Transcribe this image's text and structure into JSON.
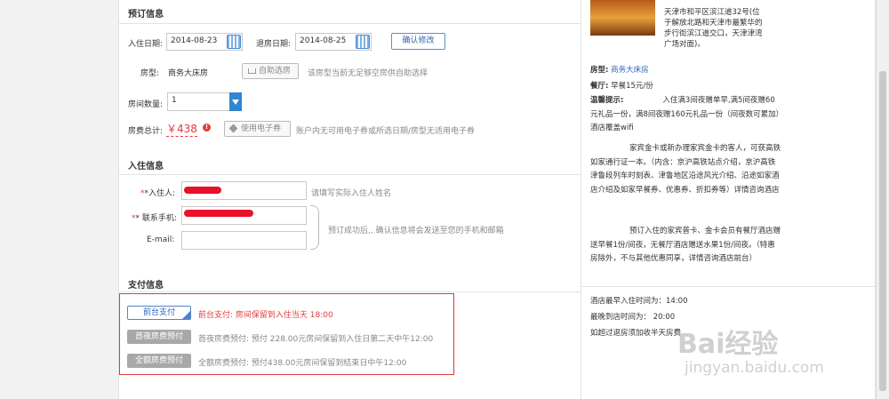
{
  "booking": {
    "section_title": "预订信息",
    "checkin_label": "入住日期:",
    "checkin_value": "2014-08-23",
    "checkout_label": "退房日期:",
    "checkout_value": "2014-08-25",
    "confirm_button": "确认修改",
    "room_type_label": "房型:",
    "room_type_value": "商务大床房",
    "self_select_button": "自助选房",
    "self_select_note": "该房型当前无足够空房供自助选择",
    "room_count_label": "房间数量:",
    "room_count_value": "1",
    "total_label": "房费总计:",
    "total_value": "￥438",
    "voucher_button": "使用电子券",
    "voucher_note": "账户内无可用电子券或所选日期/房型无适用电子券"
  },
  "guest": {
    "section_title": "入住信息",
    "name_label": "*入住人:",
    "name_hint": "请填写实际入住人姓名",
    "phone_label": "* 联系手机:",
    "email_label": "E-mail:",
    "notify_note": "预订成功后,, 确认信息将会发送至您的手机和邮箱"
  },
  "payment": {
    "section_title": "支付信息",
    "options": [
      {
        "button": "前台支付",
        "desc": "前台支付: 房间保留到入住当天 18:00",
        "active": true
      },
      {
        "button": "首夜房费预付",
        "desc": "首夜房费预付: 预付 228.00元房间保留到入住日第二天中午12:00",
        "active": false
      },
      {
        "button": "全额房费预付",
        "desc": "全额房费预付: 预付438.00元房间保留到结束日中午12:00",
        "active": false
      }
    ]
  },
  "side": {
    "address": "天津市和平区滨江道32号(位于解放北路和天津市最繁华的步行街滨江道交口，天津津湾广场对面)。",
    "room_label": "房型:",
    "room_value": "商务大床房",
    "breakfast_label": "餐厅:",
    "breakfast_value": "早餐15元/份",
    "tips_label": "温馨提示:",
    "tips_p1": "入住满3间夜赠单早,满5间夜赠60元礼品一份，满8间夜赠160元礼品一份（间夜数可累加）酒店覆盖wifi",
    "tips_p2": "家宾金卡或新办理家宾金卡的客人，可获高铁如家通行证一本。（内含：京沪高铁站点介绍，京沪高铁津鲁段列车时刻表、津鲁地区沿途风光介绍、沿途如家酒店介绍及如家早餐券、优惠券、折扣券等）详情咨询酒店",
    "tips_p3": "预订入住的家宾普卡、金卡会员有餐厅酒店赠送早餐1份/间夜，无餐厅酒店赠送水果1份/间夜。（特惠房除外，不与其他优惠同享，详情咨询酒店前台）",
    "latest_checkin": "酒店最早入住时间为：14:00",
    "latest_arrive": "最晚到店时间为： 20:00",
    "late_checkout": "如超过退房须加收半天房费"
  },
  "watermark": {
    "brand": "Bai经验",
    "url": "jingyan.baidu.com"
  }
}
